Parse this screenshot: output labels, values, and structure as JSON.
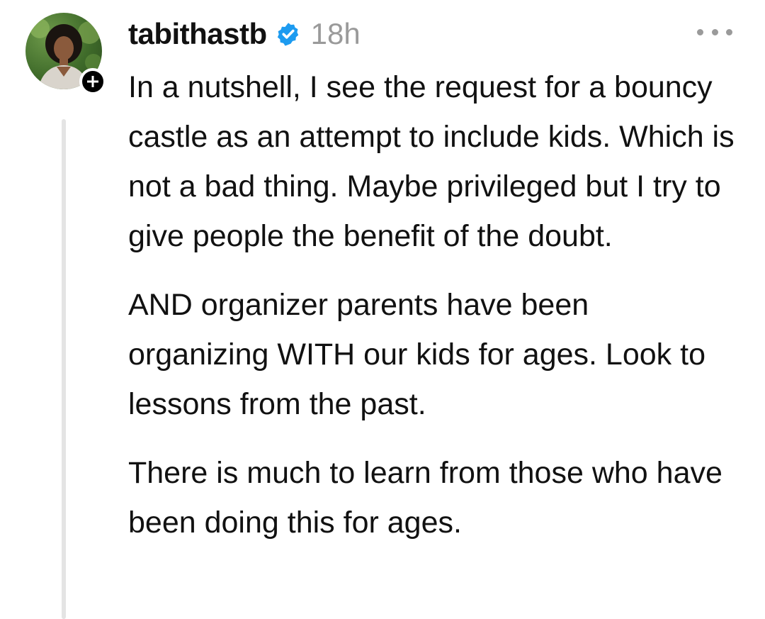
{
  "post": {
    "username": "tabithastb",
    "verified": true,
    "timestamp": "18h",
    "avatar_icon": "profile-photo",
    "follow_icon": "plus-icon",
    "more_icon": "more-horizontal-icon",
    "verified_color": "#1d9bf0",
    "paragraphs": [
      "In a nutshell, I see the request for a bouncy castle as an attempt to include kids. Which is not a bad thing. Maybe privileged but I try to give people the benefit of the doubt.",
      "AND organizer parents have been organizing WITH our kids for ages. Look to lessons from the past.",
      "There is much to learn from those who have been doing this for ages."
    ]
  }
}
